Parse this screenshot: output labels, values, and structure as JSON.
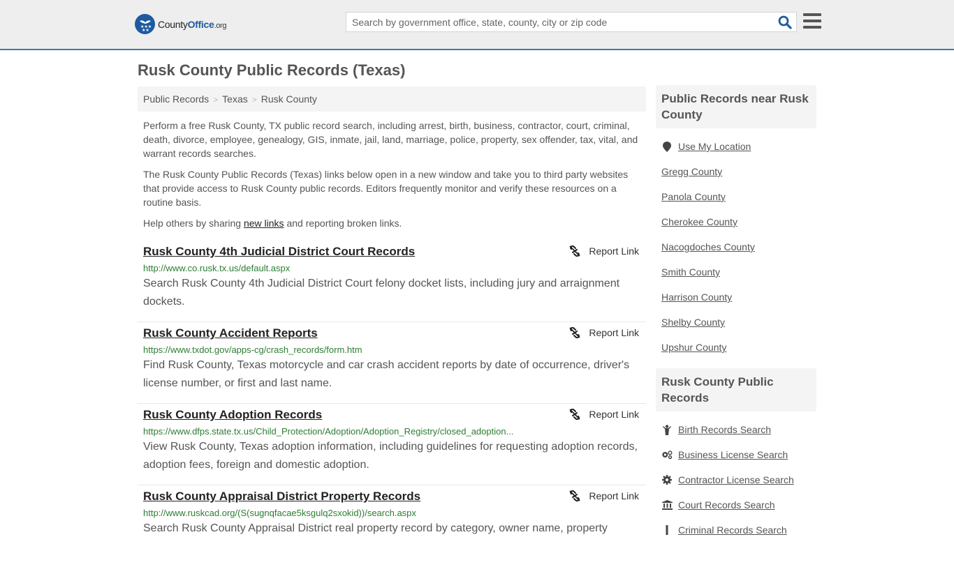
{
  "header": {
    "logo": {
      "brand_part1": "County",
      "brand_part2": "Office",
      "brand_suffix": ".org"
    },
    "search": {
      "placeholder": "Search by government office, state, county, city or zip code",
      "value": ""
    },
    "search_icon": "search-icon",
    "menu_icon": "hamburger-menu-icon"
  },
  "page": {
    "title": "Rusk County Public Records (Texas)",
    "breadcrumb": [
      "Public Records",
      "Texas",
      "Rusk County"
    ],
    "intro": {
      "p1": "Perform a free Rusk County, TX public record search, including arrest, birth, business, contractor, court, criminal, death, divorce, employee, genealogy, GIS, inmate, jail, land, marriage, police, property, sex offender, tax, vital, and warrant records searches.",
      "p2": "The Rusk County Public Records (Texas) links below open in a new window and take you to third party websites that provide access to Rusk County public records. Editors frequently monitor and verify these resources on a routine basis.",
      "p3_before": "Help others by sharing ",
      "p3_link": "new links",
      "p3_after": " and reporting broken links."
    }
  },
  "records": [
    {
      "title": "Rusk County 4th Judicial District Court Records",
      "url": "http://www.co.rusk.tx.us/default.aspx",
      "description": "Search Rusk County 4th Judicial District Court felony docket lists, including jury and arraignment dockets.",
      "report_label": "Report Link"
    },
    {
      "title": "Rusk County Accident Reports",
      "url": "https://www.txdot.gov/apps-cg/crash_records/form.htm",
      "description": "Find Rusk County, Texas motorcycle and car crash accident reports by date of occurrence, driver's license number, or first and last name.",
      "report_label": "Report Link"
    },
    {
      "title": "Rusk County Adoption Records",
      "url": "https://www.dfps.state.tx.us/Child_Protection/Adoption/Adoption_Registry/closed_adoption...",
      "description": "View Rusk County, Texas adoption information, including guidelines for requesting adoption records, adoption fees, foreign and domestic adoption.",
      "report_label": "Report Link"
    },
    {
      "title": "Rusk County Appraisal District Property Records",
      "url": "http://www.ruskcad.org/(S(sugnqfacae5ksgulq2sxokid))/search.aspx",
      "description": "Search Rusk County Appraisal District real property record by category, owner name, property",
      "report_label": "Report Link"
    }
  ],
  "sidebar": {
    "nearby": {
      "heading": "Public Records near Rusk County",
      "use_location": "Use My Location",
      "counties": [
        "Gregg County",
        "Panola County",
        "Cherokee County",
        "Nacogdoches County",
        "Smith County",
        "Harrison County",
        "Shelby County",
        "Upshur County"
      ]
    },
    "county_records": {
      "heading": "Rusk County Public Records",
      "items": [
        {
          "label": "Birth Records Search",
          "icon": "child-icon"
        },
        {
          "label": "Business License Search",
          "icon": "gears-icon"
        },
        {
          "label": "Contractor License Search",
          "icon": "gear-icon"
        },
        {
          "label": "Court Records Search",
          "icon": "courthouse-icon"
        },
        {
          "label": "Criminal Records Search",
          "icon": "criminal-icon"
        }
      ]
    }
  },
  "colors": {
    "accent": "#3a7ca8",
    "brand": "#1f5aa0",
    "url_green": "#2e7d32"
  }
}
